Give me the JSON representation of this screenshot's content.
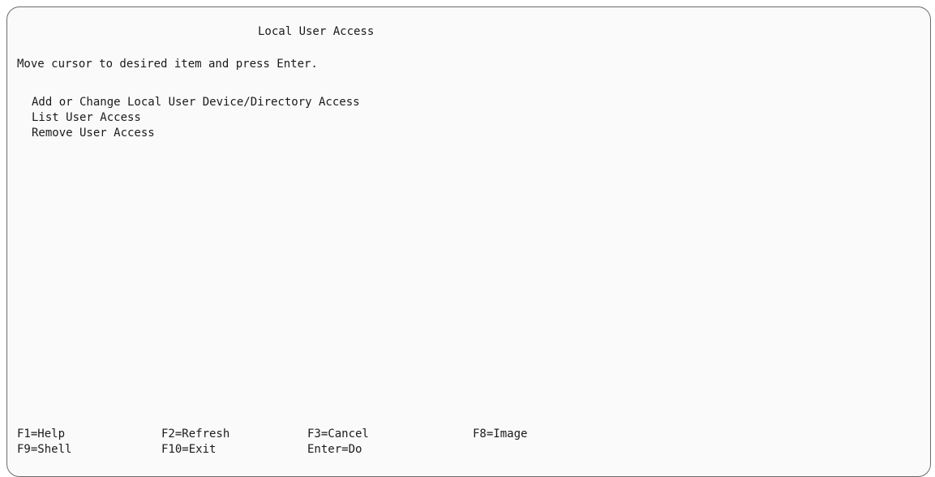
{
  "screen": {
    "title": "Local User Access",
    "instructions": "Move cursor to desired item and press Enter."
  },
  "menu": {
    "items": [
      {
        "label": "Add or Change Local User Device/Directory Access"
      },
      {
        "label": "List User Access"
      },
      {
        "label": "Remove User Access"
      }
    ]
  },
  "function_keys": {
    "row1": [
      {
        "label": "F1=Help"
      },
      {
        "label": "F2=Refresh"
      },
      {
        "label": "F3=Cancel"
      },
      {
        "label": "F8=Image"
      }
    ],
    "row2": [
      {
        "label": "F9=Shell"
      },
      {
        "label": "F10=Exit"
      },
      {
        "label": "Enter=Do"
      }
    ]
  }
}
